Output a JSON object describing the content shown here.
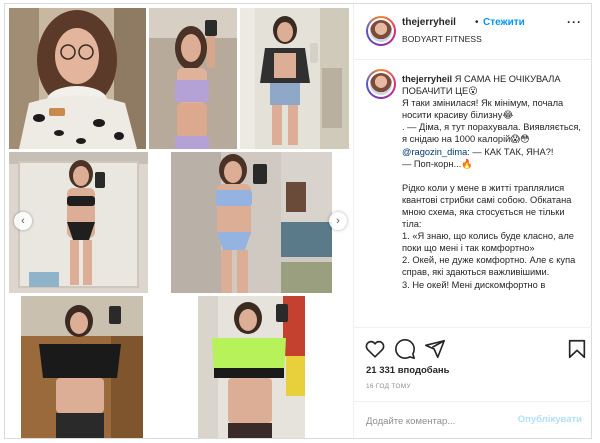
{
  "header": {
    "username": "thejerryheil",
    "separator": "•",
    "follow_label": "Стежити",
    "location": "BODYART FITNESS",
    "more": "···"
  },
  "caption": {
    "username": "thejerryheil",
    "line1": "Я САМА НЕ ОЧІКУВАЛА ПОБАЧИТИ ЦЕ😮",
    "line2": "Я таки змінилася! Як мінімум, почала носити красиву білизну😂",
    "line3": ". — Діма, я тут порахувала. Виявляється, я снідаю на 1000 калорій😱😳",
    "mention": "@ragozin_dima",
    "line4": ": — КАК ТАК, ЯНА?!",
    "line5": "— Поп-корн...🔥",
    "line6": "Рідко коли у мене в житті траплялися квантові стрибки самі собою. Обкатана мною схема, яка стосується не тільки тіла:",
    "line7": "1. «Я знаю, що колись буде класно, але поки що мені і так комфортно»",
    "line8": "2. Окей, не дуже комфортно. Але є купа справ, які здаються важливішими.",
    "line9": "3. Не окей! Мені дискомфортно в"
  },
  "actions": {
    "like_icon": "heart-icon",
    "comment_icon": "comment-icon",
    "share_icon": "share-icon",
    "save_icon": "bookmark-icon",
    "likes": "21 331 вподобань",
    "date": "16 ГОД ТОМУ"
  },
  "comment": {
    "placeholder": "Додайте коментар...",
    "publish_label": "Опублікувати"
  },
  "media": {
    "prev_icon": "chevron-left-icon",
    "next_icon": "chevron-right-icon",
    "prev_glyph": "‹",
    "next_glyph": "›"
  },
  "colors": {
    "accent": "#0095f6",
    "publish_disabled": "#b2dffc",
    "border": "#dbdbdb"
  }
}
